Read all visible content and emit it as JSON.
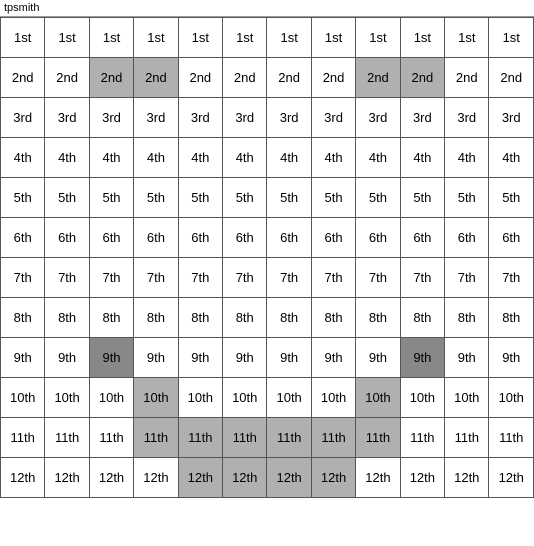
{
  "title": "tpsmith",
  "rows": [
    {
      "label": "1st",
      "cells": [
        {
          "text": "1st",
          "style": "normal"
        },
        {
          "text": "1st",
          "style": "normal"
        },
        {
          "text": "1st",
          "style": "normal"
        },
        {
          "text": "1st",
          "style": "normal"
        },
        {
          "text": "1st",
          "style": "normal"
        },
        {
          "text": "1st",
          "style": "normal"
        },
        {
          "text": "1st",
          "style": "normal"
        },
        {
          "text": "1st",
          "style": "normal"
        },
        {
          "text": "1st",
          "style": "normal"
        },
        {
          "text": "1st",
          "style": "normal"
        },
        {
          "text": "1st",
          "style": "normal"
        },
        {
          "text": "1st",
          "style": "normal"
        }
      ]
    },
    {
      "label": "2nd",
      "cells": [
        {
          "text": "2nd",
          "style": "normal"
        },
        {
          "text": "2nd",
          "style": "normal"
        },
        {
          "text": "2nd",
          "style": "highlighted"
        },
        {
          "text": "2nd",
          "style": "highlighted"
        },
        {
          "text": "2nd",
          "style": "normal"
        },
        {
          "text": "2nd",
          "style": "normal"
        },
        {
          "text": "2nd",
          "style": "normal"
        },
        {
          "text": "2nd",
          "style": "normal"
        },
        {
          "text": "2nd",
          "style": "highlighted"
        },
        {
          "text": "2nd",
          "style": "highlighted"
        },
        {
          "text": "2nd",
          "style": "normal"
        },
        {
          "text": "2nd",
          "style": "normal"
        }
      ]
    },
    {
      "label": "3rd",
      "cells": [
        {
          "text": "3rd",
          "style": "normal"
        },
        {
          "text": "3rd",
          "style": "normal"
        },
        {
          "text": "3rd",
          "style": "normal"
        },
        {
          "text": "3rd",
          "style": "normal"
        },
        {
          "text": "3rd",
          "style": "normal"
        },
        {
          "text": "3rd",
          "style": "normal"
        },
        {
          "text": "3rd",
          "style": "normal"
        },
        {
          "text": "3rd",
          "style": "normal"
        },
        {
          "text": "3rd",
          "style": "normal"
        },
        {
          "text": "3rd",
          "style": "normal"
        },
        {
          "text": "3rd",
          "style": "normal"
        },
        {
          "text": "3rd",
          "style": "normal"
        }
      ]
    },
    {
      "label": "4th",
      "cells": [
        {
          "text": "4th",
          "style": "normal"
        },
        {
          "text": "4th",
          "style": "normal"
        },
        {
          "text": "4th",
          "style": "normal"
        },
        {
          "text": "4th",
          "style": "normal"
        },
        {
          "text": "4th",
          "style": "normal"
        },
        {
          "text": "4th",
          "style": "normal"
        },
        {
          "text": "4th",
          "style": "normal"
        },
        {
          "text": "4th",
          "style": "normal"
        },
        {
          "text": "4th",
          "style": "normal"
        },
        {
          "text": "4th",
          "style": "normal"
        },
        {
          "text": "4th",
          "style": "normal"
        },
        {
          "text": "4th",
          "style": "normal"
        }
      ]
    },
    {
      "label": "5th",
      "cells": [
        {
          "text": "5th",
          "style": "normal"
        },
        {
          "text": "5th",
          "style": "normal"
        },
        {
          "text": "5th",
          "style": "normal"
        },
        {
          "text": "5th",
          "style": "normal"
        },
        {
          "text": "5th",
          "style": "normal"
        },
        {
          "text": "5th",
          "style": "normal"
        },
        {
          "text": "5th",
          "style": "normal"
        },
        {
          "text": "5th",
          "style": "normal"
        },
        {
          "text": "5th",
          "style": "normal"
        },
        {
          "text": "5th",
          "style": "normal"
        },
        {
          "text": "5th",
          "style": "normal"
        },
        {
          "text": "5th",
          "style": "normal"
        }
      ]
    },
    {
      "label": "6th",
      "cells": [
        {
          "text": "6th",
          "style": "normal"
        },
        {
          "text": "6th",
          "style": "normal"
        },
        {
          "text": "6th",
          "style": "normal"
        },
        {
          "text": "6th",
          "style": "normal"
        },
        {
          "text": "6th",
          "style": "normal"
        },
        {
          "text": "6th",
          "style": "normal"
        },
        {
          "text": "6th",
          "style": "normal"
        },
        {
          "text": "6th",
          "style": "normal"
        },
        {
          "text": "6th",
          "style": "normal"
        },
        {
          "text": "6th",
          "style": "normal"
        },
        {
          "text": "6th",
          "style": "normal"
        },
        {
          "text": "6th",
          "style": "normal"
        }
      ]
    },
    {
      "label": "7th",
      "cells": [
        {
          "text": "7th",
          "style": "normal"
        },
        {
          "text": "7th",
          "style": "normal"
        },
        {
          "text": "7th",
          "style": "normal"
        },
        {
          "text": "7th",
          "style": "normal"
        },
        {
          "text": "7th",
          "style": "normal"
        },
        {
          "text": "7th",
          "style": "normal"
        },
        {
          "text": "7th",
          "style": "normal"
        },
        {
          "text": "7th",
          "style": "normal"
        },
        {
          "text": "7th",
          "style": "normal"
        },
        {
          "text": "7th",
          "style": "normal"
        },
        {
          "text": "7th",
          "style": "normal"
        },
        {
          "text": "7th",
          "style": "normal"
        }
      ]
    },
    {
      "label": "8th",
      "cells": [
        {
          "text": "8th",
          "style": "normal"
        },
        {
          "text": "8th",
          "style": "normal"
        },
        {
          "text": "8th",
          "style": "normal"
        },
        {
          "text": "8th",
          "style": "normal"
        },
        {
          "text": "8th",
          "style": "normal"
        },
        {
          "text": "8th",
          "style": "normal"
        },
        {
          "text": "8th",
          "style": "normal"
        },
        {
          "text": "8th",
          "style": "normal"
        },
        {
          "text": "8th",
          "style": "normal"
        },
        {
          "text": "8th",
          "style": "normal"
        },
        {
          "text": "8th",
          "style": "normal"
        },
        {
          "text": "8th",
          "style": "normal"
        }
      ]
    },
    {
      "label": "9th",
      "cells": [
        {
          "text": "9th",
          "style": "normal"
        },
        {
          "text": "9th",
          "style": "normal"
        },
        {
          "text": "9th",
          "style": "dark-highlighted"
        },
        {
          "text": "9th",
          "style": "normal"
        },
        {
          "text": "9th",
          "style": "normal"
        },
        {
          "text": "9th",
          "style": "normal"
        },
        {
          "text": "9th",
          "style": "normal"
        },
        {
          "text": "9th",
          "style": "normal"
        },
        {
          "text": "9th",
          "style": "normal"
        },
        {
          "text": "9th",
          "style": "dark-highlighted"
        },
        {
          "text": "9th",
          "style": "normal"
        },
        {
          "text": "9th",
          "style": "normal"
        }
      ]
    },
    {
      "label": "10th",
      "cells": [
        {
          "text": "10th",
          "style": "normal"
        },
        {
          "text": "10th",
          "style": "normal"
        },
        {
          "text": "10th",
          "style": "normal"
        },
        {
          "text": "10th",
          "style": "highlighted"
        },
        {
          "text": "10th",
          "style": "normal"
        },
        {
          "text": "10th",
          "style": "normal"
        },
        {
          "text": "10th",
          "style": "normal"
        },
        {
          "text": "10th",
          "style": "normal"
        },
        {
          "text": "10th",
          "style": "highlighted"
        },
        {
          "text": "10th",
          "style": "normal"
        },
        {
          "text": "10th",
          "style": "normal"
        },
        {
          "text": "10th",
          "style": "normal"
        }
      ]
    },
    {
      "label": "11th",
      "cells": [
        {
          "text": "11th",
          "style": "normal"
        },
        {
          "text": "11th",
          "style": "normal"
        },
        {
          "text": "11th",
          "style": "normal"
        },
        {
          "text": "11th",
          "style": "highlighted"
        },
        {
          "text": "11th",
          "style": "highlighted"
        },
        {
          "text": "11th",
          "style": "highlighted"
        },
        {
          "text": "11th",
          "style": "highlighted"
        },
        {
          "text": "11th",
          "style": "highlighted"
        },
        {
          "text": "11th",
          "style": "highlighted"
        },
        {
          "text": "11th",
          "style": "normal"
        },
        {
          "text": "11th",
          "style": "normal"
        },
        {
          "text": "11th",
          "style": "normal"
        }
      ]
    },
    {
      "label": "12th",
      "cells": [
        {
          "text": "12th",
          "style": "normal"
        },
        {
          "text": "12th",
          "style": "normal"
        },
        {
          "text": "12th",
          "style": "normal"
        },
        {
          "text": "12th",
          "style": "normal"
        },
        {
          "text": "12th",
          "style": "highlighted"
        },
        {
          "text": "12th",
          "style": "highlighted"
        },
        {
          "text": "12th",
          "style": "highlighted"
        },
        {
          "text": "12th",
          "style": "highlighted"
        },
        {
          "text": "12th",
          "style": "normal"
        },
        {
          "text": "12th",
          "style": "normal"
        },
        {
          "text": "12th",
          "style": "normal"
        },
        {
          "text": "12th",
          "style": "normal"
        }
      ]
    }
  ]
}
